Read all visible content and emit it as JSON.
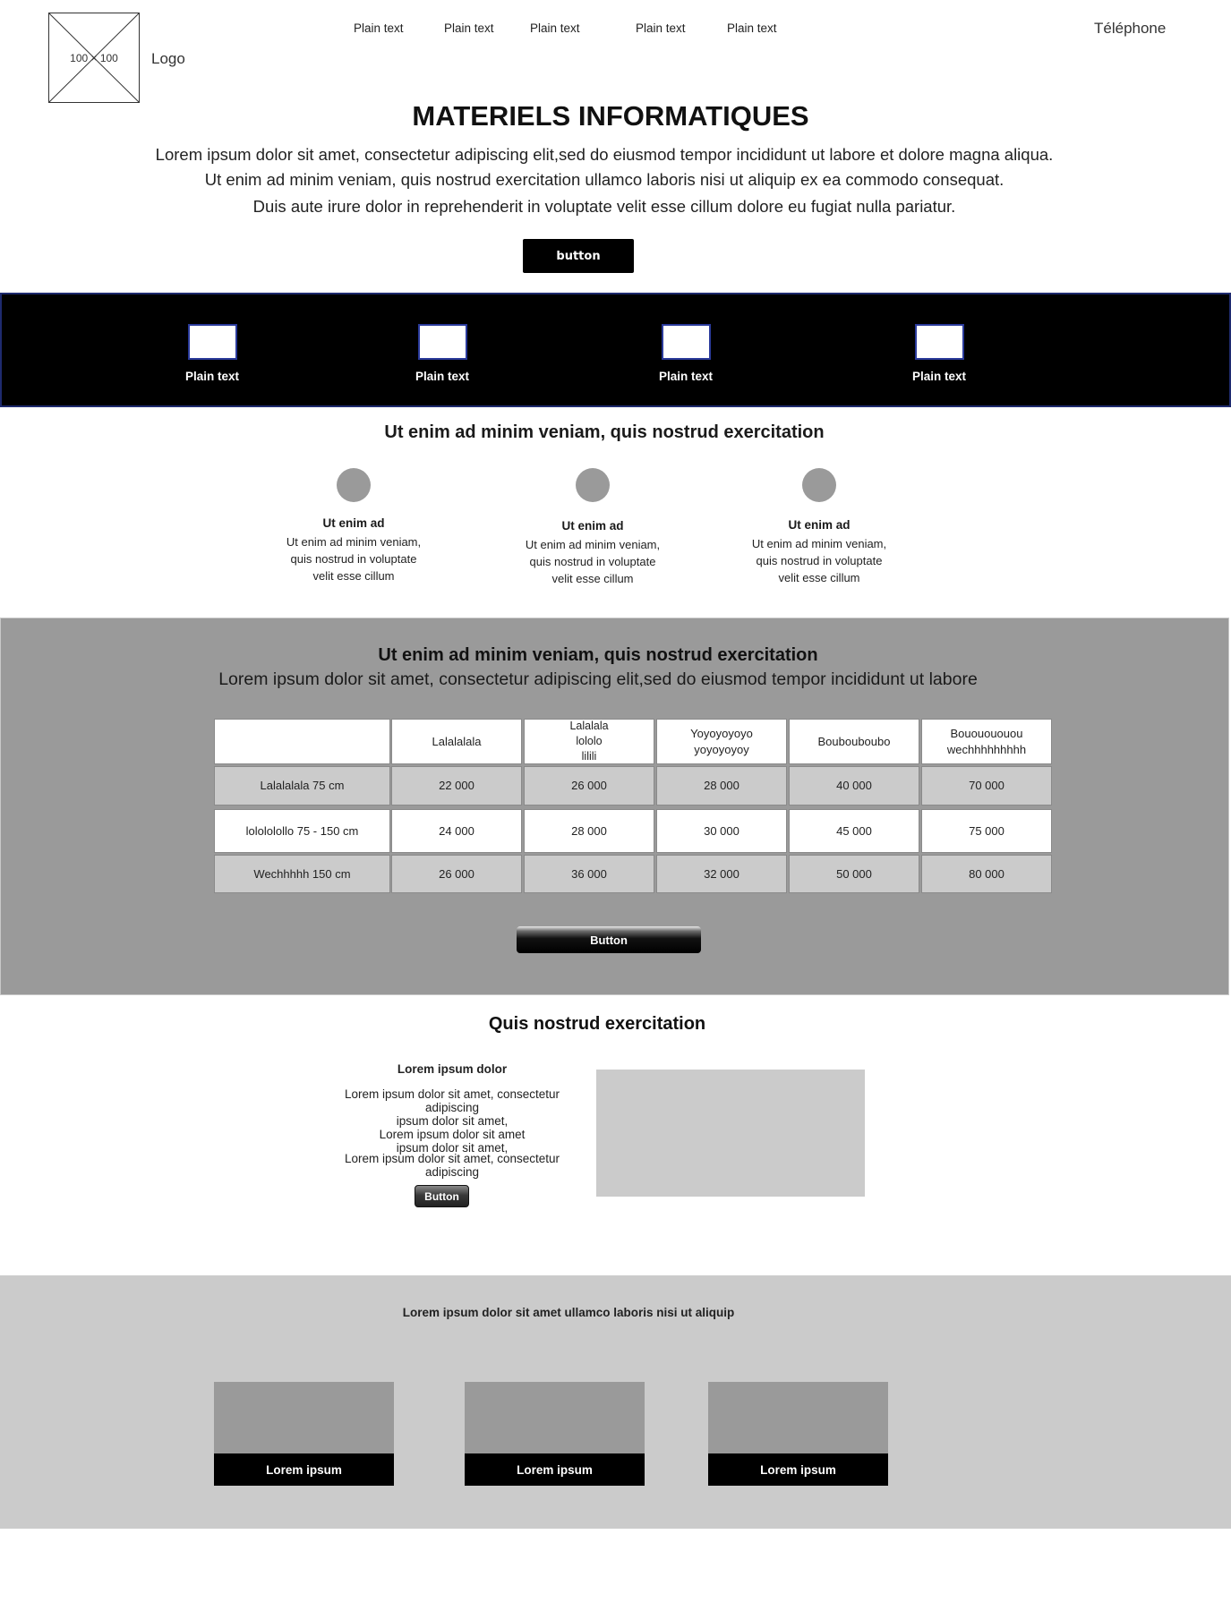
{
  "header": {
    "logo_placeholder": "100 × 100",
    "logo_label": "Logo",
    "nav": [
      "Plain text",
      "Plain text",
      "Plain text",
      "Plain text",
      "Plain text"
    ],
    "phone": "Téléphone"
  },
  "hero": {
    "title": "MATERIELS INFORMATIQUES",
    "lines": [
      "Lorem ipsum dolor sit amet, consectetur adipiscing elit,sed do eiusmod tempor incididunt ut labore et dolore magna aliqua.",
      "Ut enim ad minim veniam, quis nostrud exercitation ullamco laboris nisi ut aliquip ex ea commodo consequat.",
      "Duis aute irure dolor in reprehenderit in voluptate velit esse cillum dolore eu fugiat nulla pariatur."
    ],
    "button": "button"
  },
  "features": [
    "Plain text",
    "Plain text",
    "Plain text",
    "Plain text"
  ],
  "section2": {
    "title": "Ut enim ad minim veniam, quis nostrud exercitation",
    "cols": [
      {
        "title": "Ut enim ad",
        "line1": "Ut enim ad minim veniam,",
        "line2": "quis nostrud in voluptate",
        "line3": "velit esse cillum"
      },
      {
        "title": "Ut enim ad",
        "line1": "Ut enim ad minim veniam,",
        "line2": "quis nostrud in voluptate",
        "line3": "velit esse cillum"
      },
      {
        "title": "Ut enim ad",
        "line1": "Ut enim ad minim veniam,",
        "line2": "quis nostrud in voluptate",
        "line3": "velit esse cillum"
      }
    ]
  },
  "pricing": {
    "title": "Ut enim ad minim veniam, quis nostrud exercitation",
    "subtitle": "Lorem ipsum dolor sit amet, consectetur adipiscing elit,sed do eiusmod tempor incididunt ut labore",
    "headers": [
      "",
      "Lalalalala",
      "Lalalala\nlololo\nlilili",
      "Yoyoyoyoyo\nyoyoyoyoy",
      "Boubouboubo",
      "Bououououou\nwechhhhhhhhh"
    ],
    "rows": [
      [
        "Lalalalala 75 cm",
        "22 000",
        "26 000",
        "28 000",
        "40 000",
        "70 000"
      ],
      [
        "lolololollo 75 - 150 cm",
        "24 000",
        "28 000",
        "30 000",
        "45 000",
        "75 000"
      ],
      [
        "Wechhhhh 150 cm",
        "26 000",
        "36 000",
        "32 000",
        "50 000",
        "80 000"
      ]
    ],
    "button": "Button"
  },
  "quis": {
    "title": "Quis nostrud exercitation",
    "heading": "Lorem ipsum dolor",
    "lines": [
      "Lorem ipsum dolor sit amet, consectetur adipiscing",
      "ipsum dolor sit amet,",
      "Lorem ipsum dolor sit amet",
      "ipsum dolor sit amet,"
    ],
    "last_line": "Lorem ipsum dolor sit amet, consectetur adipiscing",
    "button": "Button"
  },
  "footer": {
    "title": "Lorem ipsum dolor sit amet ullamco laboris nisi ut aliquip",
    "cards": [
      "Lorem ipsum",
      "Lorem ipsum",
      "Lorem ipsum"
    ]
  }
}
